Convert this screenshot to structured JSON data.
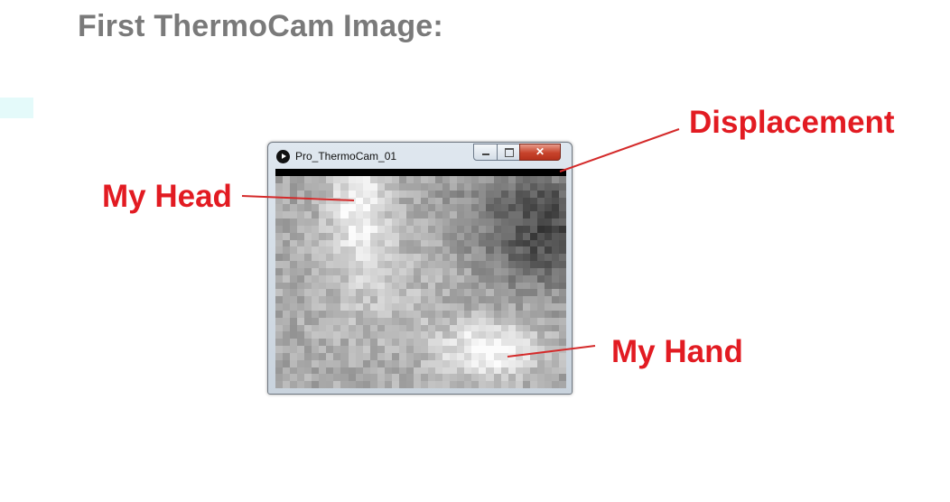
{
  "slide": {
    "title": "First ThermoCam Image:"
  },
  "window": {
    "title": "Pro_ThermoCam_01",
    "app_icon": "play-icon",
    "controls": [
      "minimize-icon",
      "maximize-icon",
      "close-icon"
    ]
  },
  "annotations": {
    "displacement": "Displacement",
    "my_head": "My Head",
    "my_hand": "My Hand",
    "color": "#e21b22"
  }
}
